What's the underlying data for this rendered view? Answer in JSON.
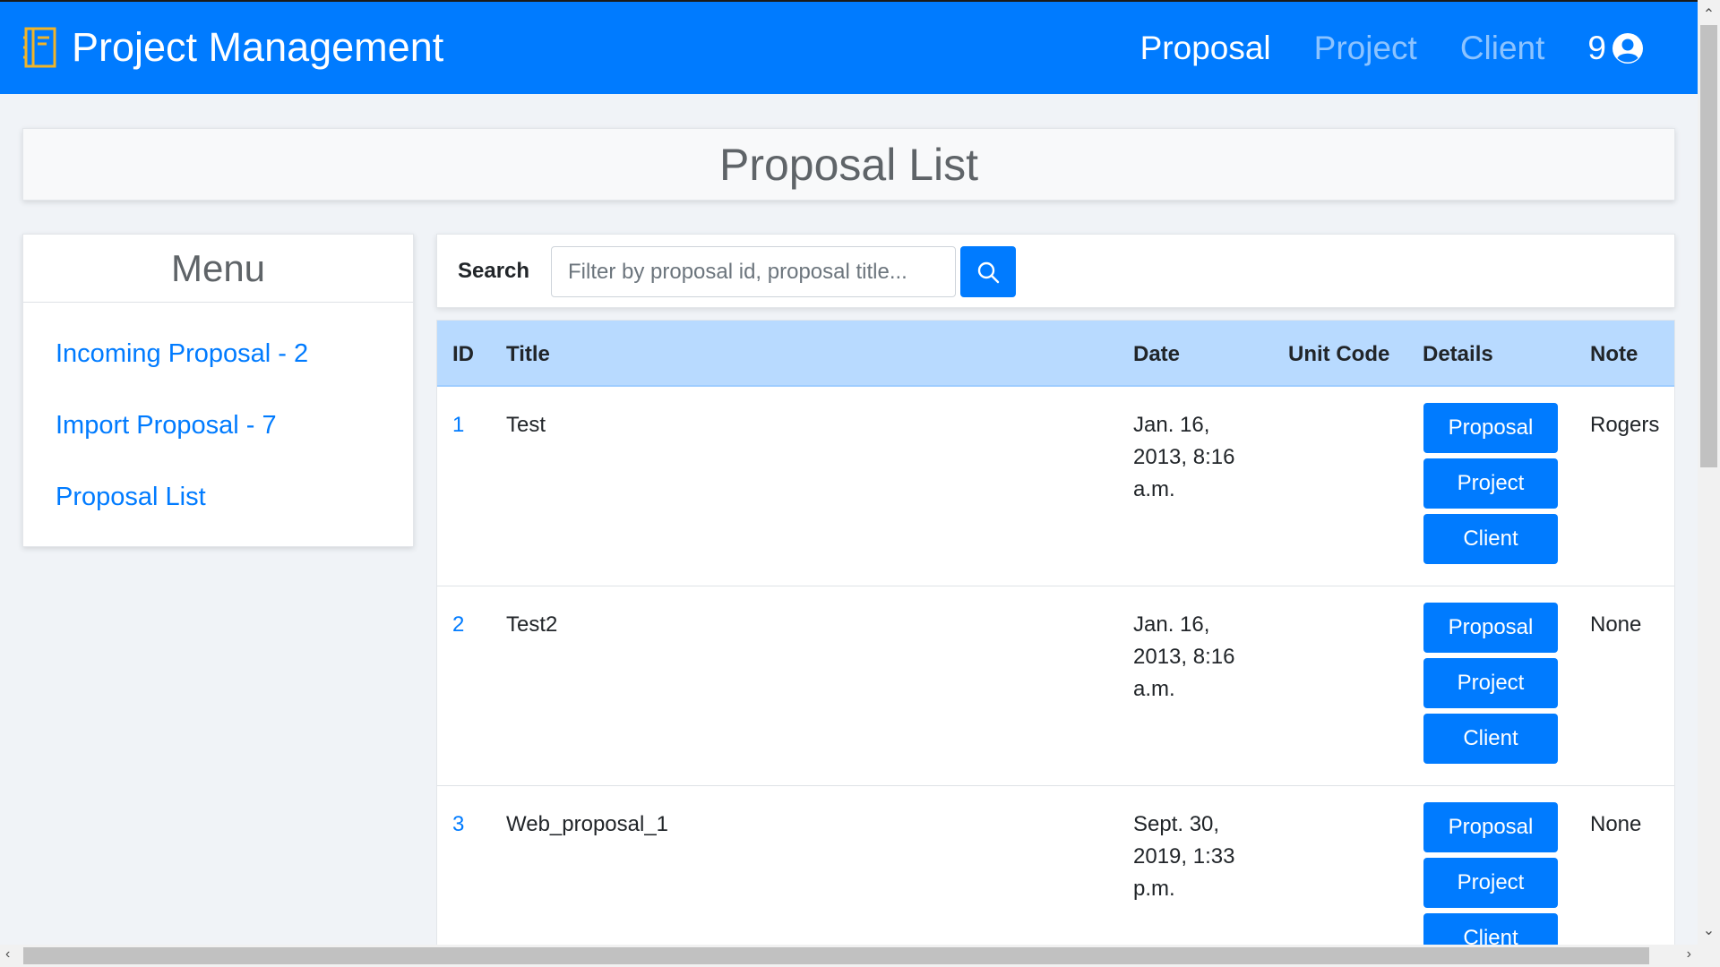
{
  "navbar": {
    "brand": "Project Management",
    "links": [
      {
        "label": "Proposal",
        "active": true
      },
      {
        "label": "Project",
        "active": false
      },
      {
        "label": "Client",
        "active": false
      }
    ],
    "user_count": "9",
    "user_icon": "user-circle-icon",
    "brand_icon": "notebook-icon"
  },
  "page": {
    "title": "Proposal List"
  },
  "menu": {
    "title": "Menu",
    "items": [
      {
        "label": "Incoming Proposal - 2"
      },
      {
        "label": "Import Proposal - 7"
      },
      {
        "label": "Proposal List"
      }
    ]
  },
  "search": {
    "label": "Search",
    "placeholder": "Filter by proposal id, proposal title...",
    "value": "",
    "button_icon": "search-icon"
  },
  "table": {
    "headers": {
      "id": "ID",
      "title": "Title",
      "date": "Date",
      "unit_code": "Unit Code",
      "details": "Details",
      "note": "Note"
    },
    "detail_buttons": [
      "Proposal",
      "Project",
      "Client"
    ],
    "rows": [
      {
        "id": "1",
        "title": "Test",
        "date_lines": [
          "Jan. 16,",
          "2013, 8:16",
          "a.m."
        ],
        "unit_code": "",
        "note": "Rogers"
      },
      {
        "id": "2",
        "title": "Test2",
        "date_lines": [
          "Jan. 16,",
          "2013, 8:16",
          "a.m."
        ],
        "unit_code": "",
        "note": "None"
      },
      {
        "id": "3",
        "title": "Web_proposal_1",
        "date_lines": [
          "Sept. 30,",
          "2019, 1:33",
          "p.m."
        ],
        "unit_code": "",
        "note": "None"
      }
    ]
  },
  "colors": {
    "primary": "#007bff",
    "table_header": "#b8daff",
    "background": "#f0f3f7"
  }
}
